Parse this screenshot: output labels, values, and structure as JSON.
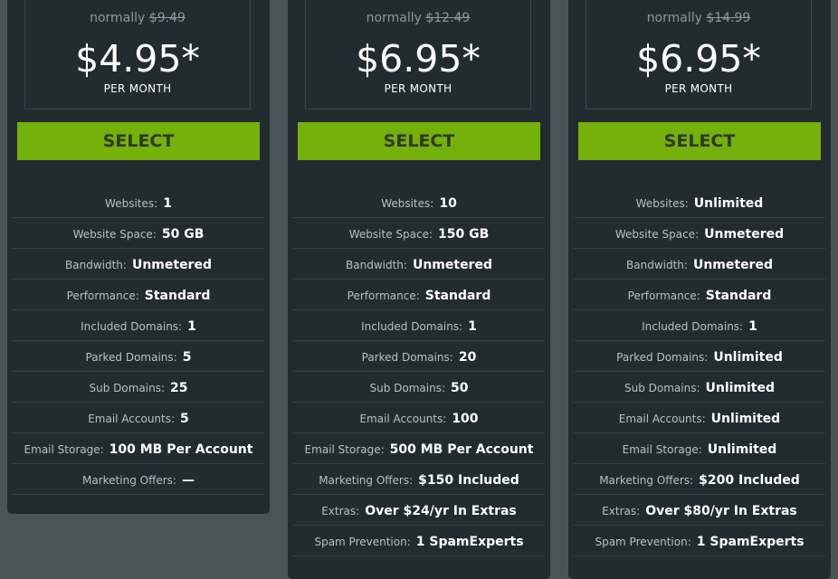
{
  "plans": [
    {
      "normally_label": "normally",
      "old_price": "$9.49",
      "price": "$4.95*",
      "per": "PER MONTH",
      "select_label": "SELECT",
      "features": [
        {
          "label": "Websites:",
          "value": "1"
        },
        {
          "label": "Website Space:",
          "value": "50 GB"
        },
        {
          "label": "Bandwidth:",
          "value": "Unmetered"
        },
        {
          "label": "Performance:",
          "value": "Standard"
        },
        {
          "label": "Included Domains:",
          "value": "1"
        },
        {
          "label": "Parked Domains:",
          "value": "5"
        },
        {
          "label": "Sub Domains:",
          "value": "25"
        },
        {
          "label": "Email Accounts:",
          "value": "5"
        },
        {
          "label": "Email Storage:",
          "value": "100 MB Per Account"
        },
        {
          "label": "Marketing Offers:",
          "value": "—"
        }
      ]
    },
    {
      "normally_label": "normally",
      "old_price": "$12.49",
      "price": "$6.95*",
      "per": "PER MONTH",
      "select_label": "SELECT",
      "features": [
        {
          "label": "Websites:",
          "value": "10"
        },
        {
          "label": "Website Space:",
          "value": "150 GB"
        },
        {
          "label": "Bandwidth:",
          "value": "Unmetered"
        },
        {
          "label": "Performance:",
          "value": "Standard"
        },
        {
          "label": "Included Domains:",
          "value": "1"
        },
        {
          "label": "Parked Domains:",
          "value": "20"
        },
        {
          "label": "Sub Domains:",
          "value": "50"
        },
        {
          "label": "Email Accounts:",
          "value": "100"
        },
        {
          "label": "Email Storage:",
          "value": "500 MB Per Account"
        },
        {
          "label": "Marketing Offers:",
          "value": "$150 Included"
        },
        {
          "label": "Extras:",
          "value": "Over $24/yr In Extras"
        },
        {
          "label": "Spam Prevention:",
          "value": "1 SpamExperts"
        }
      ]
    },
    {
      "normally_label": "normally",
      "old_price": "$14.99",
      "price": "$6.95*",
      "per": "PER MONTH",
      "select_label": "SELECT",
      "features": [
        {
          "label": "Websites:",
          "value": "Unlimited"
        },
        {
          "label": "Website Space:",
          "value": "Unmetered"
        },
        {
          "label": "Bandwidth:",
          "value": "Unmetered"
        },
        {
          "label": "Performance:",
          "value": "Standard"
        },
        {
          "label": "Included Domains:",
          "value": "1"
        },
        {
          "label": "Parked Domains:",
          "value": "Unlimited"
        },
        {
          "label": "Sub Domains:",
          "value": "Unlimited"
        },
        {
          "label": "Email Accounts:",
          "value": "Unlimited"
        },
        {
          "label": "Email Storage:",
          "value": "Unlimited"
        },
        {
          "label": "Marketing Offers:",
          "value": "$200 Included"
        },
        {
          "label": "Extras:",
          "value": "Over $80/yr In Extras"
        },
        {
          "label": "Spam Prevention:",
          "value": "1 SpamExperts"
        }
      ]
    }
  ]
}
